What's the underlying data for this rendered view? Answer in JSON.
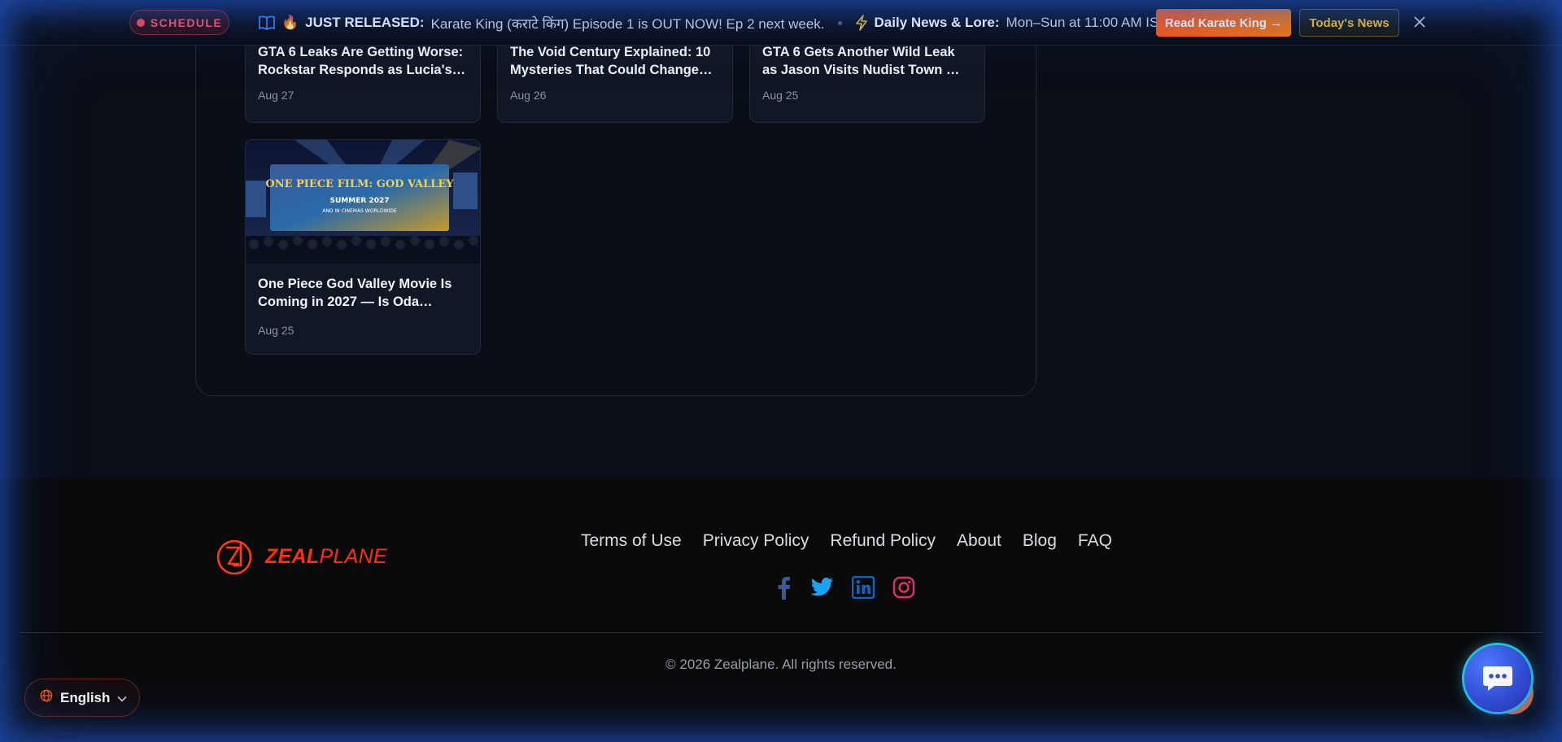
{
  "announcement": {
    "schedule_label": "SCHEDULE",
    "release_emoji": "🔥",
    "release_heading": "JUST RELEASED:",
    "release_text": "Karate King (कराटे किंग) Episode 1 is OUT NOW! Ep 2 next week.",
    "news_heading": "Daily News & Lore:",
    "news_text": "Mon–Sun at 11:00 AM IST",
    "read_button": "Read Karate King →",
    "news_button": "Today's News",
    "icons": [
      "book-icon",
      "lightning-icon",
      "close-icon"
    ]
  },
  "articles": [
    {
      "title_line1": "GTA 6 Leaks Are Getting Worse:",
      "title_line2": "Rockstar Responds as Lucia's…",
      "date": "Aug 27"
    },
    {
      "title_line1": "The Void Century Explained: 10",
      "title_line2": "Mysteries That Could Change…",
      "date": "Aug 26"
    },
    {
      "title_line1": "GTA 6 Gets Another Wild Leak",
      "title_line2": "as Jason Visits Nudist Town …",
      "date": "Aug 25"
    },
    {
      "title_line1": "One Piece God Valley Movie Is",
      "title_line2": "Coming in 2027 — Is Oda…",
      "date": "Aug 25",
      "image_text": {
        "headline": "ONE PIECE FILM: GOD VALLEY",
        "line1": "SUMMER 2027",
        "line2": "AND IN CINEMAS WORLDWIDE"
      }
    }
  ],
  "footer": {
    "brand_bold": "ZEAL",
    "brand_rest": "PLANE",
    "links": [
      "Terms of Use",
      "Privacy Policy",
      "Refund Policy",
      "About",
      "Blog",
      "FAQ"
    ],
    "social": [
      "facebook-icon",
      "twitter-icon",
      "linkedin-icon",
      "instagram-icon"
    ],
    "copyright": "© 2026 Zealplane. All rights reserved."
  },
  "language": {
    "label": "English"
  },
  "colors": {
    "accent": "#ff5a14",
    "brand": "#ff2e12",
    "news": "#f2c230"
  }
}
